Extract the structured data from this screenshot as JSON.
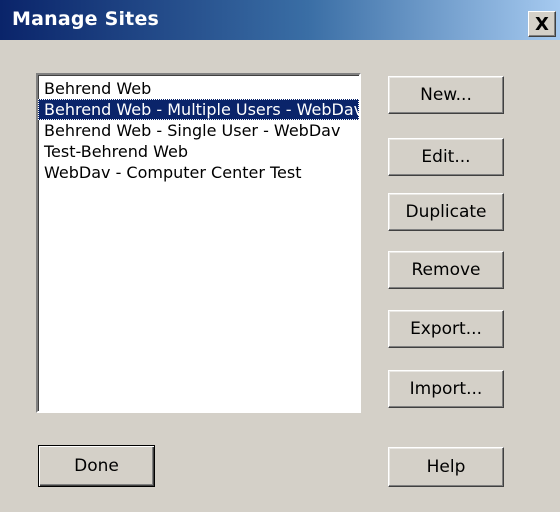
{
  "window": {
    "title": "Manage Sites",
    "close_label": "X"
  },
  "sites_list": {
    "items": [
      {
        "label": "Behrend Web",
        "selected": false
      },
      {
        "label": "Behrend Web - Multiple Users - WebDav",
        "selected": true
      },
      {
        "label": "Behrend Web - Single User - WebDav",
        "selected": false
      },
      {
        "label": "Test-Behrend Web",
        "selected": false
      },
      {
        "label": "WebDav - Computer Center Test",
        "selected": false
      }
    ]
  },
  "buttons": {
    "new": "New...",
    "edit": "Edit...",
    "duplicate": "Duplicate",
    "remove": "Remove",
    "export": "Export...",
    "import": "Import...",
    "done": "Done",
    "help": "Help"
  }
}
